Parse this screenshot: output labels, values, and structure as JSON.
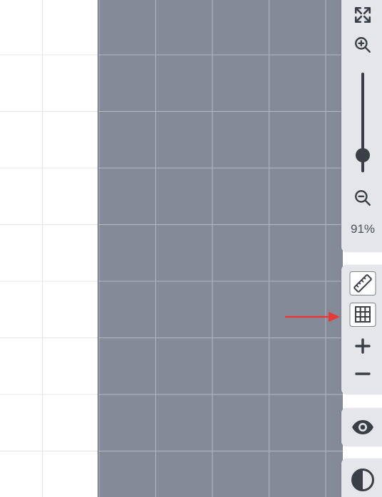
{
  "zoom": {
    "level_text": "91%",
    "slider_level": 0.83
  },
  "colors": {
    "page_background": "#858a98",
    "panel_background": "#e4e6ea",
    "icon_color": "#3a3e46",
    "arrow_color": "#e53935"
  },
  "icons": {
    "fullscreen": "expand-arrows-icon",
    "zoom_in": "zoom-in-icon",
    "zoom_out": "zoom-out-icon",
    "ruler": "ruler-icon",
    "grid": "grid-icon",
    "add": "plus-icon",
    "remove": "minus-icon",
    "preview": "eye-icon",
    "contrast": "contrast-icon"
  }
}
